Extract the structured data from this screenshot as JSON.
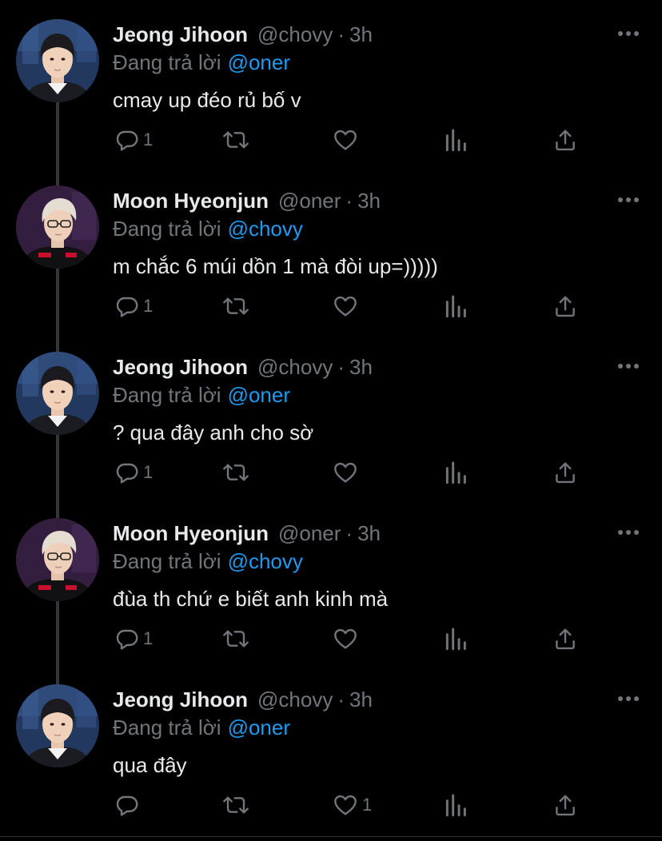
{
  "thread": {
    "tweets": [
      {
        "display_name": "Jeong Jihoon",
        "handle": "@chovy",
        "separator": "·",
        "time": "3h",
        "reply_prefix": "Đang trả lời",
        "reply_to": "@oner",
        "text": "cmay up đéo rủ bố v",
        "avatar": "chovy-avatar",
        "replies": "1",
        "retweets": "",
        "likes": ""
      },
      {
        "display_name": "Moon Hyeonjun",
        "handle": "@oner",
        "separator": "·",
        "time": "3h",
        "reply_prefix": "Đang trả lời",
        "reply_to": "@chovy",
        "text": "m chắc 6 múi dồn 1 mà đòi up=)))))",
        "avatar": "oner-avatar",
        "replies": "1",
        "retweets": "",
        "likes": ""
      },
      {
        "display_name": "Jeong Jihoon",
        "handle": "@chovy",
        "separator": "·",
        "time": "3h",
        "reply_prefix": "Đang trả lời",
        "reply_to": "@oner",
        "text": "? qua đây anh cho sờ",
        "avatar": "chovy-avatar",
        "replies": "1",
        "retweets": "",
        "likes": ""
      },
      {
        "display_name": "Moon Hyeonjun",
        "handle": "@oner",
        "separator": "·",
        "time": "3h",
        "reply_prefix": "Đang trả lời",
        "reply_to": "@chovy",
        "text": "đùa th chứ e biết anh kinh mà",
        "avatar": "oner-avatar",
        "replies": "1",
        "retweets": "",
        "likes": ""
      },
      {
        "display_name": "Jeong Jihoon",
        "handle": "@chovy",
        "separator": "·",
        "time": "3h",
        "reply_prefix": "Đang trả lời",
        "reply_to": "@oner",
        "text": "qua đây",
        "avatar": "chovy-avatar",
        "replies": "",
        "retweets": "",
        "likes": "1"
      }
    ]
  },
  "colors": {
    "background": "#000000",
    "text_primary": "#e7e9ea",
    "text_secondary": "#71767b",
    "accent_link": "#1d9bf0",
    "thread_line": "#333639"
  },
  "icons": {
    "more": "more-horizontal-icon",
    "reply": "reply-icon",
    "retweet": "retweet-icon",
    "like": "heart-icon",
    "views": "views-icon",
    "share": "share-icon"
  }
}
